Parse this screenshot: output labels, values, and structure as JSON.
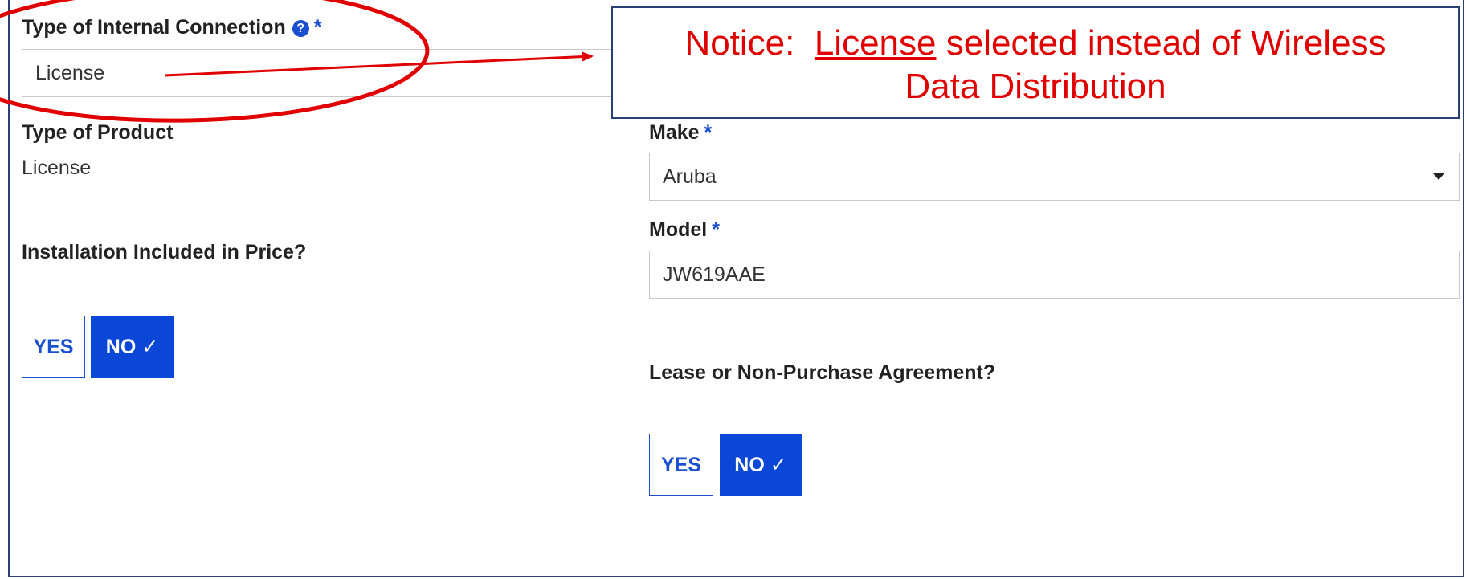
{
  "form": {
    "internal_connection": {
      "label": "Type of Internal Connection",
      "help_icon": "question-circle-icon",
      "required_marker": "*",
      "value": "License"
    },
    "product_type": {
      "label": "Type of Product",
      "value": "License"
    },
    "installation": {
      "label": "Installation Included in Price?",
      "yes_label": "YES",
      "no_label": "NO ✓",
      "selected": "NO"
    },
    "make": {
      "label": "Make",
      "required_marker": "*",
      "value": "Aruba"
    },
    "model": {
      "label": "Model",
      "required_marker": "*",
      "value": "JW619AAE"
    },
    "lease": {
      "label": "Lease or Non-Purchase Agreement?",
      "yes_label": "YES",
      "no_label": "NO ✓",
      "selected": "NO"
    }
  },
  "annotation": {
    "prefix": "Notice:  ",
    "underlined": "License",
    "line1_rest": " selected instead of Wireless",
    "line2": "Data Distribution",
    "color": "#e00000"
  },
  "colors": {
    "accent": "#0a47d6",
    "frame": "#2a3f73"
  }
}
